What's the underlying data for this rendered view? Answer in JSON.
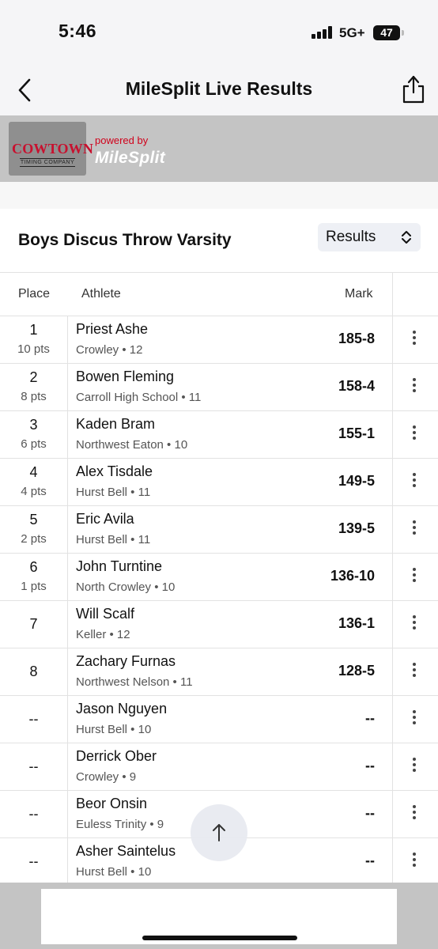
{
  "status_bar": {
    "time": "5:46",
    "network": "5G+",
    "battery": "47"
  },
  "nav": {
    "title": "MileSplit Live Results",
    "back_icon": "chevron-left-icon",
    "share_icon": "share-icon"
  },
  "banner": {
    "logo_main": "COWTOWN",
    "logo_sub": "TIMING COMPANY",
    "powered_by": "powered by",
    "brand": "MileSplit",
    "accent_color": "#c8102e"
  },
  "event": {
    "title": "Boys Discus Throw Varsity",
    "view_selected": "Results"
  },
  "table": {
    "headers": {
      "place": "Place",
      "athlete": "Athlete",
      "mark": "Mark"
    },
    "rows": [
      {
        "place": "1",
        "pts": "10 pts",
        "name": "Priest Ashe",
        "team": "Crowley • 12",
        "mark": "185-8"
      },
      {
        "place": "2",
        "pts": "8 pts",
        "name": "Bowen Fleming",
        "team": "Carroll High School • 11",
        "mark": "158-4"
      },
      {
        "place": "3",
        "pts": "6 pts",
        "name": "Kaden Bram",
        "team": "Northwest Eaton • 10",
        "mark": "155-1"
      },
      {
        "place": "4",
        "pts": "4 pts",
        "name": "Alex Tisdale",
        "team": "Hurst Bell • 11",
        "mark": "149-5"
      },
      {
        "place": "5",
        "pts": "2 pts",
        "name": "Eric Avila",
        "team": "Hurst Bell • 11",
        "mark": "139-5"
      },
      {
        "place": "6",
        "pts": "1 pts",
        "name": "John Turntine",
        "team": "North Crowley • 10",
        "mark": "136-10"
      },
      {
        "place": "7",
        "pts": "",
        "name": "Will Scalf",
        "team": "Keller • 12",
        "mark": "136-1"
      },
      {
        "place": "8",
        "pts": "",
        "name": "Zachary Furnas",
        "team": "Northwest Nelson • 11",
        "mark": "128-5"
      },
      {
        "place": "--",
        "pts": "",
        "name": "Jason Nguyen",
        "team": "Hurst Bell • 10",
        "mark": "--"
      },
      {
        "place": "--",
        "pts": "",
        "name": "Derrick Ober",
        "team": "Crowley • 9",
        "mark": "--"
      },
      {
        "place": "--",
        "pts": "",
        "name": "Beor Onsin",
        "team": "Euless Trinity • 9",
        "mark": "--"
      },
      {
        "place": "--",
        "pts": "",
        "name": "Asher Saintelus",
        "team": "Hurst Bell • 10",
        "mark": "--"
      }
    ]
  },
  "icons": {
    "row_menu": "more-vertical-icon",
    "scroll_top": "arrow-up-icon",
    "select": "chevron-up-down-icon"
  }
}
